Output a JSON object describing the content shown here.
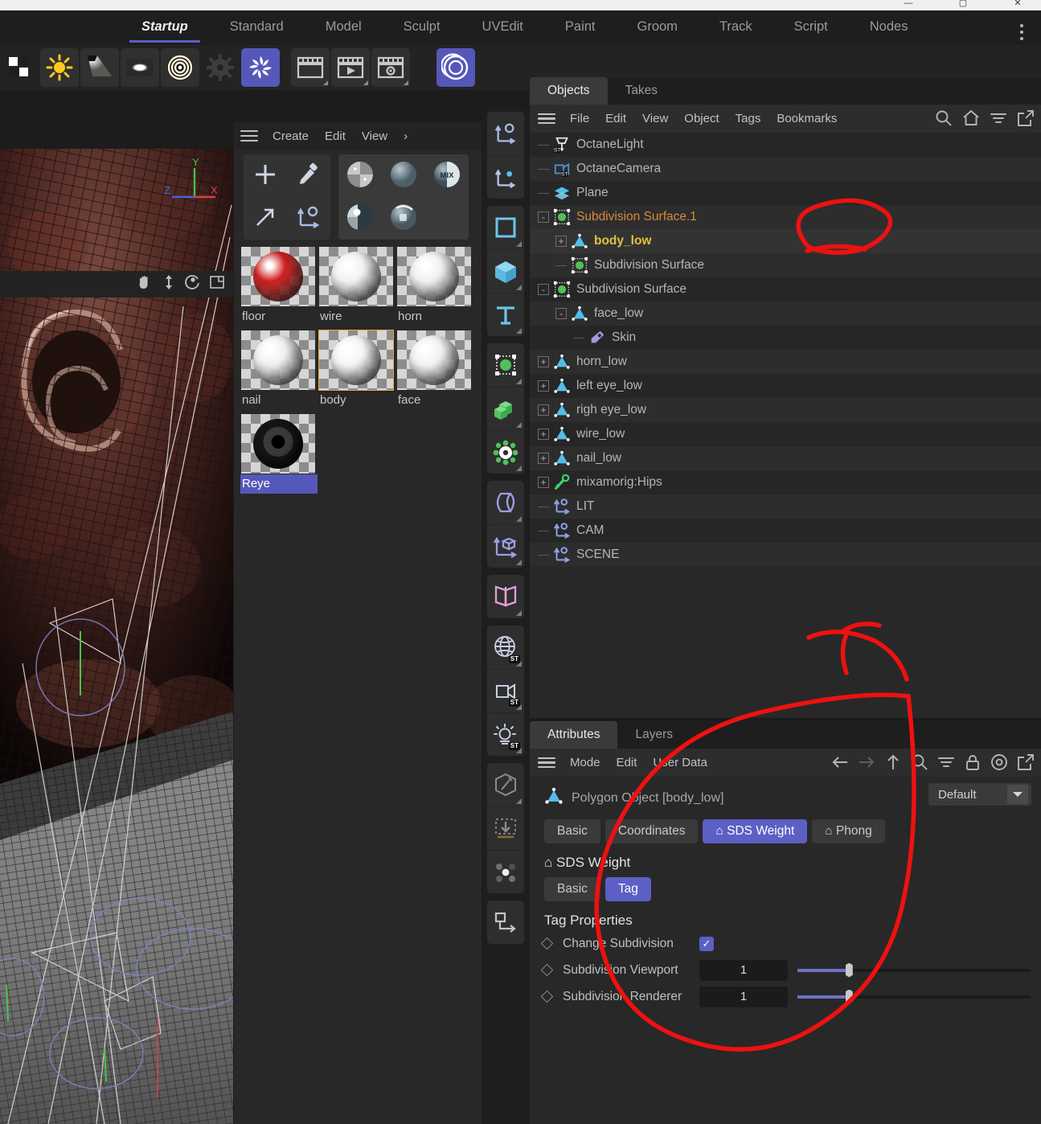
{
  "window": {
    "minimize": "—",
    "maximize": "▢",
    "close": "✕"
  },
  "layout_tabs": [
    {
      "label": "Startup",
      "active": true
    },
    {
      "label": "Standard",
      "active": false
    },
    {
      "label": "Model",
      "active": false
    },
    {
      "label": "Sculpt",
      "active": false
    },
    {
      "label": "UVEdit",
      "active": false
    },
    {
      "label": "Paint",
      "active": false
    },
    {
      "label": "Groom",
      "active": false
    },
    {
      "label": "Track",
      "active": false
    },
    {
      "label": "Script",
      "active": false
    },
    {
      "label": "Nodes",
      "active": false
    }
  ],
  "top_toolbar": {
    "icons": [
      {
        "name": "render-region-icon",
        "selected": false
      },
      {
        "name": "sun-light-icon",
        "selected": false
      },
      {
        "name": "spot-light-icon",
        "selected": false
      },
      {
        "name": "area-light-icon",
        "selected": false
      },
      {
        "name": "target-light-icon",
        "selected": false
      },
      {
        "name": "gear-settings-icon",
        "selected": false
      },
      {
        "name": "octane-render-icon",
        "selected": true
      },
      {
        "name": "render-view-icon",
        "selected": false
      },
      {
        "name": "render-play-icon",
        "selected": false
      },
      {
        "name": "render-settings-icon",
        "selected": false
      },
      {
        "name": "octane-sphere-icon",
        "selected": true
      }
    ]
  },
  "viewport": {
    "nav_icons": [
      "pan-icon",
      "zoom-icon",
      "rotate-icon",
      "maximize-view-icon"
    ],
    "axis": {
      "x": "X",
      "y": "Y",
      "z": "Z",
      "x_color": "#d94040",
      "y_color": "#3ec24d",
      "z_color": "#3a6ad9"
    }
  },
  "material_manager": {
    "menu": [
      "Create",
      "Edit",
      "View"
    ],
    "more_label": "›",
    "tools": [
      {
        "name": "add-material-icon"
      },
      {
        "name": "eyedropper-icon"
      },
      {
        "name": "arrow-apply-icon"
      },
      {
        "name": "axis-icon"
      }
    ],
    "previews": [
      {
        "name": "checker-material-preview"
      },
      {
        "name": "plain-material-preview"
      },
      {
        "name": "mix-material-preview",
        "label": "MIX"
      },
      {
        "name": "glossy-material-preview"
      },
      {
        "name": "specular-material-preview"
      }
    ],
    "materials": [
      {
        "name": "floor",
        "color": "#cf2020",
        "selected": false,
        "label_selected": false,
        "kind": "sphere"
      },
      {
        "name": "wire",
        "color": "#f2f2f2",
        "selected": false,
        "label_selected": false,
        "kind": "sphere"
      },
      {
        "name": "horn",
        "color": "#f0f0f0",
        "selected": false,
        "label_selected": false,
        "kind": "sphere"
      },
      {
        "name": "nail",
        "color": "#f0f0f0",
        "selected": false,
        "label_selected": false,
        "kind": "sphere"
      },
      {
        "name": "body",
        "color": "#f4f4f4",
        "selected": true,
        "label_selected": false,
        "kind": "sphere"
      },
      {
        "name": "face",
        "color": "#f2f2f2",
        "selected": false,
        "label_selected": false,
        "kind": "sphere"
      },
      {
        "name": "Reye",
        "color": "#2a2a2a",
        "selected": false,
        "label_selected": true,
        "kind": "eye"
      }
    ]
  },
  "vtoolbar": {
    "groups": [
      {
        "icons": [
          {
            "name": "axis-world-icon",
            "corner": false
          },
          {
            "name": "axis-object-icon",
            "corner": false
          }
        ]
      },
      {
        "icons": [
          {
            "name": "spline-rect-icon",
            "corner": true
          },
          {
            "name": "cube-primitive-icon",
            "corner": true
          },
          {
            "name": "text-spline-icon",
            "corner": true
          }
        ]
      },
      {
        "icons": [
          {
            "name": "subdivision-surface-icon",
            "corner": true
          },
          {
            "name": "array-generator-icon",
            "corner": true
          },
          {
            "name": "mograph-cloner-icon",
            "corner": true
          }
        ]
      },
      {
        "icons": [
          {
            "name": "bend-deformer-icon",
            "corner": true
          },
          {
            "name": "coordinate-deformer-icon",
            "corner": true
          }
        ]
      },
      {
        "icons": [
          {
            "name": "symmetry-deformer-icon",
            "corner": true
          }
        ]
      },
      {
        "icons": [
          {
            "name": "environment-st-icon",
            "corner": true,
            "badge": "ST"
          },
          {
            "name": "camera-st-icon",
            "corner": true,
            "badge": "ST"
          },
          {
            "name": "light-st-icon",
            "corner": true,
            "badge": "ST"
          }
        ]
      },
      {
        "icons": [
          {
            "name": "edit-polygon-pen-icon",
            "corner": true
          },
          {
            "name": "project-axis-icon",
            "corner": false
          },
          {
            "name": "point-group-icon",
            "corner": false
          }
        ]
      },
      {
        "icons": [
          {
            "name": "connect-object-icon",
            "corner": false
          }
        ]
      }
    ]
  },
  "objects_panel": {
    "tabs": [
      {
        "label": "Objects",
        "active": true
      },
      {
        "label": "Takes",
        "active": false
      }
    ],
    "menu": [
      "File",
      "Edit",
      "View",
      "Object",
      "Tags",
      "Bookmarks"
    ],
    "tools": [
      "search-icon",
      "home-icon",
      "filter-icon",
      "popout-icon"
    ],
    "rows": [
      {
        "name": "OctaneLight",
        "icon": "octane-light-icon",
        "indent": 0,
        "expander": null,
        "color": "normal",
        "edit": true,
        "dots": true,
        "check": "green",
        "tags": [
          {
            "type": "light-thumb"
          }
        ]
      },
      {
        "name": "OctaneCamera",
        "icon": "octane-camera-icon",
        "indent": 0,
        "expander": null,
        "color": "normal",
        "edit": true,
        "dots": true,
        "check": "target",
        "tags": [
          {
            "type": "camera-thumb"
          }
        ]
      },
      {
        "name": "Plane",
        "icon": "plane-object-icon",
        "indent": 0,
        "expander": null,
        "color": "normal",
        "edit": true,
        "dots": true,
        "check": "green",
        "tags": [
          {
            "type": "flag"
          },
          {
            "type": "mat-red"
          }
        ]
      },
      {
        "name": "Subdivision Surface.1",
        "icon": "subdivision-icon",
        "indent": 0,
        "expander": "-",
        "color": "orange",
        "edit": true,
        "dots": true,
        "check": "green",
        "tags": []
      },
      {
        "name": "body_low",
        "icon": "polygon-object-icon",
        "indent": 1,
        "expander": "+",
        "color": "yellow",
        "edit": true,
        "dots": true,
        "check": "none",
        "selected": true,
        "tags": [
          {
            "type": "weight"
          },
          {
            "type": "checker"
          },
          {
            "type": "sds",
            "selected": true
          },
          {
            "type": "flag"
          },
          {
            "type": "mat-white-dark"
          }
        ]
      },
      {
        "name": "Subdivision Surface",
        "icon": "subdivision-icon",
        "indent": 1,
        "expander": null,
        "color": "normal",
        "edit": true,
        "dots": true,
        "check": "green",
        "tags": []
      },
      {
        "name": "Subdivision Surface",
        "icon": "subdivision-icon",
        "indent": 0,
        "expander": "-",
        "color": "normal",
        "edit": true,
        "dots": true,
        "check": "green",
        "tags": []
      },
      {
        "name": "face_low",
        "icon": "polygon-object-icon",
        "indent": 1,
        "expander": "-",
        "color": "normal",
        "edit": true,
        "dots": true,
        "check": "none",
        "tags": [
          {
            "type": "weight"
          },
          {
            "type": "checker"
          },
          {
            "type": "sds"
          },
          {
            "type": "flag"
          },
          {
            "type": "mat-white"
          }
        ]
      },
      {
        "name": "Skin",
        "icon": "skin-tag-icon",
        "indent": 2,
        "expander": null,
        "color": "normal",
        "edit": true,
        "dots": true,
        "check": "green",
        "tags": []
      },
      {
        "name": "horn_low",
        "icon": "polygon-object-icon",
        "indent": 0,
        "expander": "+",
        "color": "normal",
        "edit": true,
        "dots": true,
        "check": "none",
        "tags": [
          {
            "type": "weight"
          },
          {
            "type": "checker"
          },
          {
            "type": "flag"
          },
          {
            "type": "mat-white"
          }
        ]
      },
      {
        "name": "left eye_low",
        "icon": "polygon-object-icon",
        "indent": 0,
        "expander": "+",
        "color": "normal",
        "edit": true,
        "dots": true,
        "check": "none",
        "tags": [
          {
            "type": "weight"
          },
          {
            "type": "checker"
          },
          {
            "type": "flag"
          },
          {
            "type": "mat-eye"
          }
        ]
      },
      {
        "name": "righ eye_low",
        "icon": "polygon-object-icon",
        "indent": 0,
        "expander": "+",
        "color": "normal",
        "edit": true,
        "dots": true,
        "check": "none",
        "tags": [
          {
            "type": "weight"
          },
          {
            "type": "checker"
          },
          {
            "type": "flag"
          },
          {
            "type": "mat-eye"
          }
        ]
      },
      {
        "name": "wire_low",
        "icon": "polygon-object-icon",
        "indent": 0,
        "expander": "+",
        "color": "normal",
        "edit": true,
        "dots": true,
        "check": "none",
        "tags": [
          {
            "type": "weight"
          },
          {
            "type": "checker"
          },
          {
            "type": "flag"
          },
          {
            "type": "mat-white"
          }
        ]
      },
      {
        "name": "nail_low",
        "icon": "polygon-object-icon",
        "indent": 0,
        "expander": "+",
        "color": "normal",
        "edit": true,
        "dots": true,
        "check": "none",
        "tags": [
          {
            "type": "weight"
          },
          {
            "type": "checker"
          },
          {
            "type": "flag"
          },
          {
            "type": "mat-white"
          }
        ]
      },
      {
        "name": "mixamorig:Hips",
        "icon": "joint-icon",
        "indent": 0,
        "expander": "+",
        "color": "normal",
        "edit": true,
        "dots": true,
        "check": "none",
        "tags": []
      },
      {
        "name": "LIT",
        "icon": "null-object-icon",
        "indent": 0,
        "expander": null,
        "color": "normal",
        "edit": false,
        "dots": true,
        "check": "none",
        "swatch": "#ffffff",
        "tags": []
      },
      {
        "name": "CAM",
        "icon": "null-object-icon",
        "indent": 0,
        "expander": null,
        "color": "normal",
        "edit": false,
        "dots": true,
        "check": "none",
        "swatch": "#000000",
        "tags": []
      },
      {
        "name": "SCENE",
        "icon": "null-object-icon",
        "indent": 0,
        "expander": null,
        "color": "normal",
        "edit": false,
        "dots": true,
        "check": "none",
        "swatch": "#737da8",
        "tags": []
      }
    ]
  },
  "attributes_panel": {
    "tabs": [
      {
        "label": "Attributes",
        "active": true
      },
      {
        "label": "Layers",
        "active": false
      }
    ],
    "menu": [
      "Mode",
      "Edit",
      "User Data"
    ],
    "tools": [
      "back-arrow-icon",
      "forward-arrow-icon",
      "up-arrow-icon",
      "search-icon",
      "filter-icon",
      "lock-icon",
      "target-icon",
      "popout-icon"
    ],
    "object_title": "Polygon Object [body_low]",
    "preset_dropdown": "Default",
    "tabs_row": [
      {
        "label": "Basic",
        "active": false
      },
      {
        "label": "Coordinates",
        "active": false
      },
      {
        "label": "⌂ SDS Weight",
        "active": true
      },
      {
        "label": "⌂ Phong",
        "active": false
      }
    ],
    "section_title": "⌂ SDS Weight",
    "subtabs": [
      {
        "label": "Basic",
        "active": false
      },
      {
        "label": "Tag",
        "active": true
      }
    ],
    "properties_title": "Tag Properties",
    "properties": [
      {
        "label": "Change Subdivision",
        "type": "checkbox",
        "value": true,
        "checkmark": "✓"
      },
      {
        "label": "Subdivision Viewport",
        "type": "slider",
        "value": "1",
        "fill_pct": 22
      },
      {
        "label": "Subdivision Renderer",
        "type": "slider",
        "value": "1",
        "fill_pct": 22
      }
    ]
  },
  "annotation": {
    "color": "#ee1111",
    "shapes": [
      "circle-around-sds-tag",
      "arrow-to-attributes",
      "circle-around-tag-properties"
    ]
  }
}
